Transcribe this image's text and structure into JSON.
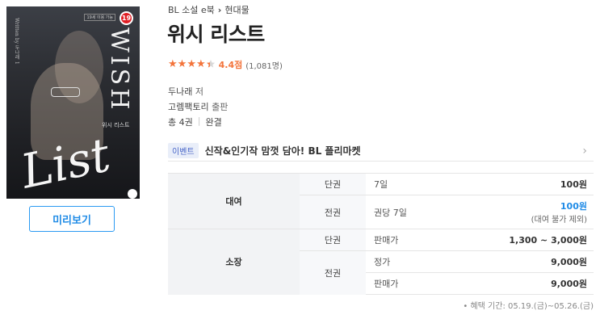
{
  "cover": {
    "age_badge": "19",
    "age_note": "19세 이용 가능",
    "wish_text": "WISH",
    "list_text": "List",
    "small_title": "위시 리스트",
    "spine_text": "Written by 두나래 1"
  },
  "preview_button": "미리보기",
  "breadcrumb": {
    "category": "BL 소설 e북",
    "separator": "›",
    "subcategory": "현대물"
  },
  "title": "위시 리스트",
  "rating": {
    "stars": 4.4,
    "score_text": "4.4점",
    "count_text": "(1,081명)"
  },
  "meta": {
    "author_name": "두나래",
    "author_suffix": "저",
    "publisher_name": "고렘팩토리",
    "publisher_suffix": "출판",
    "volumes": "총 4권",
    "divider": "|",
    "status": "완결"
  },
  "event": {
    "tag": "이벤트",
    "text": "신작&인기작 맘껏 담아! BL 플리마켓",
    "arrow": "›"
  },
  "price_table": {
    "rent_label": "대여",
    "own_label": "소장",
    "rows": {
      "rent_single": {
        "sub": "단권",
        "label": "7일",
        "value": "100원"
      },
      "rent_set": {
        "sub": "전권",
        "label": "권당 7일",
        "value": "100원",
        "note": "(대여 불가 제외)"
      },
      "own_single": {
        "sub": "단권",
        "label": "판매가",
        "value": "1,300 ~ 3,000원"
      },
      "own_set_regular": {
        "sub": "전권",
        "label": "정가",
        "value": "9,000원"
      },
      "own_set_sale": {
        "label": "판매가",
        "value": "9,000원"
      }
    }
  },
  "benefit": "• 혜택 기간: 05.19.(금)~05.26.(금)",
  "colors": {
    "accent_blue": "#1f8be6",
    "star_orange": "#f3743b"
  }
}
